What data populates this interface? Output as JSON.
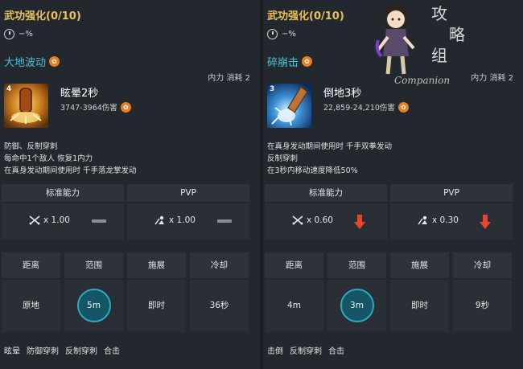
{
  "panels": [
    {
      "header": "武功强化(0/10)",
      "cooldown": "−%",
      "skill_name": "大地波动",
      "cost": "内力 消耗 2",
      "icon_number": "4",
      "effect_name": "眩晕2秒",
      "damage": "3747-3964伤害",
      "desc": [
        "防御、反制穿刺",
        "每命中1个敌人 恢复1内力",
        "在真身发动期间使用时 千手落龙掌发动"
      ],
      "std_label": "标准能力",
      "pvp_label": "PVP",
      "std_mult": "x 1.00",
      "pvp_mult": "x 1.00",
      "std_state": "neutral",
      "pvp_state": "neutral",
      "grid_headers": [
        "距离",
        "范围",
        "施展",
        "冷却"
      ],
      "grid_values": [
        "原地",
        "5m",
        "即时",
        "36秒"
      ],
      "tags": [
        "眩晕",
        "防御穿刺",
        "反制穿刺",
        "合击"
      ]
    },
    {
      "header": "武功强化(0/10)",
      "cooldown": "−%",
      "skill_name": "碎崩击",
      "cost": "内力 消耗 2",
      "icon_number": "3",
      "effect_name": "倒地3秒",
      "damage": "22,859-24,210伤害",
      "desc": [
        "在真身发动期间使用时 千手双拳发动",
        "反制穿刺",
        "在3秒内移动速度降低50%"
      ],
      "std_label": "标准能力",
      "pvp_label": "PVP",
      "std_mult": "x 0.60",
      "pvp_mult": "x 0.30",
      "std_state": "down",
      "pvp_state": "down",
      "grid_headers": [
        "距离",
        "范围",
        "施展",
        "冷却"
      ],
      "grid_values": [
        "4m",
        "3m",
        "即时",
        "9秒"
      ],
      "tags": [
        "击倒",
        "反制穿刺",
        "合击"
      ]
    }
  ],
  "overlay": {
    "watermark_text": "Companion",
    "calligraphy": "攻略组"
  },
  "colors": {
    "header": "#e8c25a",
    "skill_name": "#4fc3d4",
    "down_arrow": "#e8452c",
    "range_circle": "#2fa8bf"
  }
}
